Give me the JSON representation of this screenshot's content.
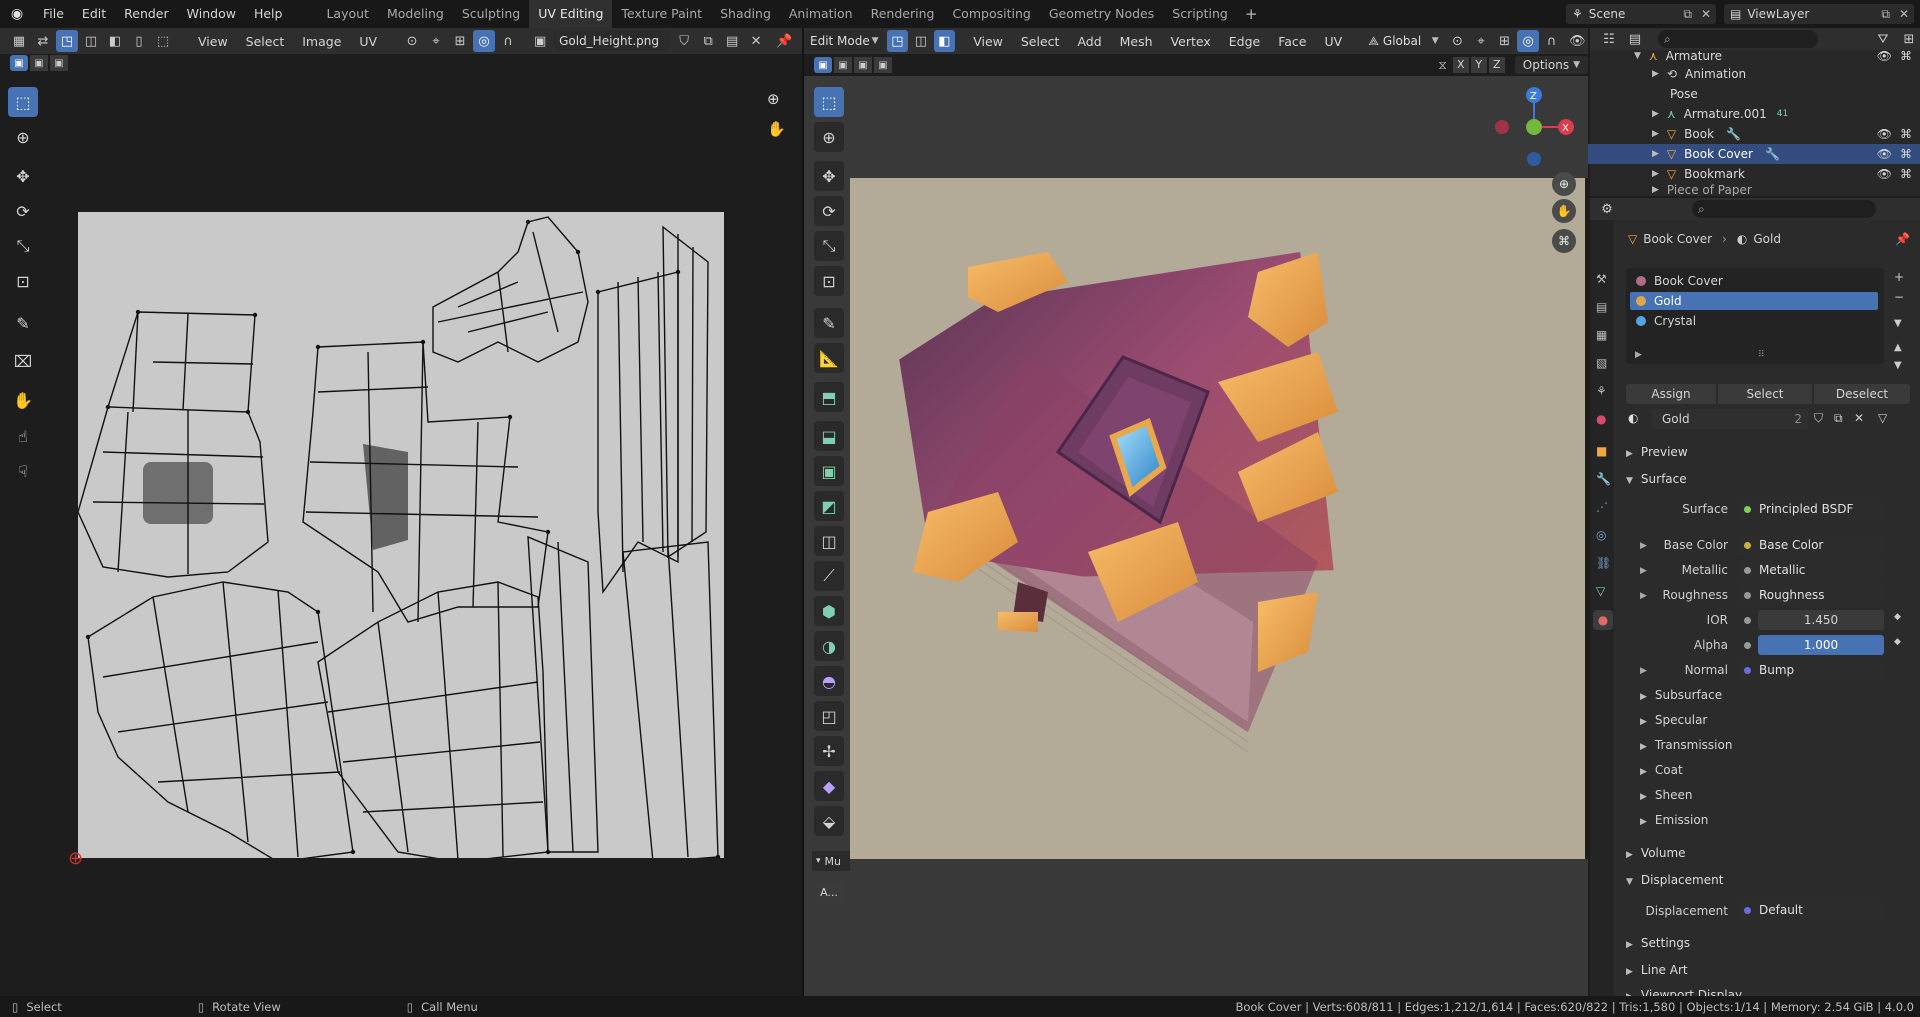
{
  "menu": [
    "File",
    "Edit",
    "Render",
    "Window",
    "Help"
  ],
  "workspaces": [
    "Layout",
    "Modeling",
    "Sculpting",
    "UV Editing",
    "Texture Paint",
    "Shading",
    "Animation",
    "Rendering",
    "Compositing",
    "Geometry Nodes",
    "Scripting"
  ],
  "active_workspace": "UV Editing",
  "scene": "Scene",
  "view_layer": "ViewLayer",
  "uv_editor": {
    "menus": [
      "View",
      "Select",
      "Image",
      "UV"
    ],
    "image_name": "Gold_Height.png"
  },
  "viewport": {
    "mode": "Edit Mode",
    "menus": [
      "View",
      "Select",
      "Add",
      "Mesh",
      "Vertex",
      "Edge",
      "Face",
      "UV"
    ],
    "orientation": "Global",
    "options_label": "Options",
    "axes": [
      "X",
      "Y",
      "Z"
    ],
    "gizmo": {
      "x": "X",
      "y": "Y",
      "z": "Z"
    },
    "panel_label": "Mu",
    "panel_btn": "A..."
  },
  "outliner": {
    "rows": [
      {
        "name": "Armature",
        "level": 0
      },
      {
        "name": "Animation",
        "level": 1
      },
      {
        "name": "Pose",
        "level": 1
      },
      {
        "name": "Armature.001",
        "level": 0,
        "badge": "41"
      },
      {
        "name": "Book",
        "level": 0
      },
      {
        "name": "Book Cover",
        "level": 0,
        "selected": true
      },
      {
        "name": "Bookmark",
        "level": 0
      },
      {
        "name": "Piece of Paper",
        "level": 0
      }
    ]
  },
  "properties": {
    "breadcrumb_object": "Book Cover",
    "breadcrumb_material": "Gold",
    "slots": [
      {
        "name": "Book Cover",
        "color": "#b46a86"
      },
      {
        "name": "Gold",
        "color": "#e0a84a",
        "selected": true
      },
      {
        "name": "Crystal",
        "color": "#4fa7e0"
      }
    ],
    "assign": "Assign",
    "select": "Select",
    "deselect": "Deselect",
    "material_name": "Gold",
    "user_count": "2",
    "sections": {
      "preview": "Preview",
      "surface": "Surface",
      "volume": "Volume",
      "displacement": "Displacement",
      "settings": "Settings",
      "line_art": "Line Art",
      "viewport_display": "Viewport Display"
    },
    "surface_label": "Surface",
    "surface_value": "Principled BSDF",
    "inputs": [
      {
        "label": "Base Color",
        "value": "Base Color",
        "type": "link"
      },
      {
        "label": "Metallic",
        "value": "Metallic",
        "type": "link"
      },
      {
        "label": "Roughness",
        "value": "Roughness",
        "type": "link"
      },
      {
        "label": "IOR",
        "value": "1.450",
        "type": "num"
      },
      {
        "label": "Alpha",
        "value": "1.000",
        "type": "slider",
        "fill": 1.0
      },
      {
        "label": "Normal",
        "value": "Bump",
        "type": "link"
      }
    ],
    "subpanels": [
      "Subsurface",
      "Specular",
      "Transmission",
      "Coat",
      "Sheen",
      "Emission"
    ],
    "displacement_label": "Displacement",
    "displacement_value": "Default"
  },
  "status": {
    "left": [
      {
        "key": "Select"
      },
      {
        "key": "Rotate View"
      },
      {
        "key": "Call Menu"
      }
    ],
    "stats": "Book Cover | Verts:608/811 | Edges:1,212/1,614 | Faces:620/822 | Tris:1,580 | Objects:1/14 | Memory: 2.54 GiB | 4.0.0"
  },
  "colors": {
    "accent": "#4772b3",
    "uv_bg": "#c9c9c9",
    "viewport_bg": "#b3aa98",
    "book_purple": "#8e4a6e",
    "gold": "#e3a04b",
    "crystal": "#4aa8e0"
  }
}
